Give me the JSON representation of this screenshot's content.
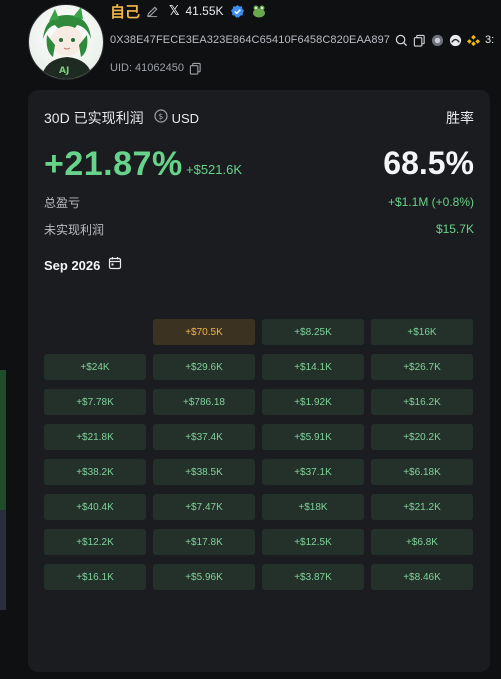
{
  "profile": {
    "name": "自己",
    "followers": "41.55K",
    "address": "0X38E47FECE3EA323E864C65410F6458C820EAA897",
    "address_extra": "3:",
    "uid": "UID: 41062450"
  },
  "card": {
    "title": "30D 已实现利润",
    "currency": "USD",
    "winrate_label": "胜率",
    "pnl_pct": "+21.87%",
    "pnl_abs": "+$521.6K",
    "winrate": "68.5%",
    "total_label": "总盈亏",
    "total_value": "+$1.1M (+0.8%)",
    "unrealized_label": "未实现利润",
    "unrealized_value": "$15.7K",
    "month": "Sep 2026"
  },
  "calendar": {
    "cells": [
      "",
      "+$70.5K",
      "+$8.25K",
      "+$16K",
      "+$24K",
      "+$29.6K",
      "+$14.1K",
      "+$26.7K",
      "+$7.78K",
      "+$786.18",
      "+$1.92K",
      "+$16.2K",
      "+$21.8K",
      "+$37.4K",
      "+$5.91K",
      "+$20.2K",
      "+$38.2K",
      "+$38.5K",
      "+$37.1K",
      "+$6.18K",
      "+$40.4K",
      "+$7.47K",
      "+$18K",
      "+$21.2K",
      "+$12.2K",
      "+$17.8K",
      "+$12.5K",
      "+$6.8K",
      "+$16.1K",
      "+$5.96K",
      "+$3.87K",
      "+$8.46K"
    ]
  },
  "colors": {
    "accent_green": "#67d38a",
    "name_gold": "#f2b64a",
    "highlight": "#f0b44a"
  }
}
